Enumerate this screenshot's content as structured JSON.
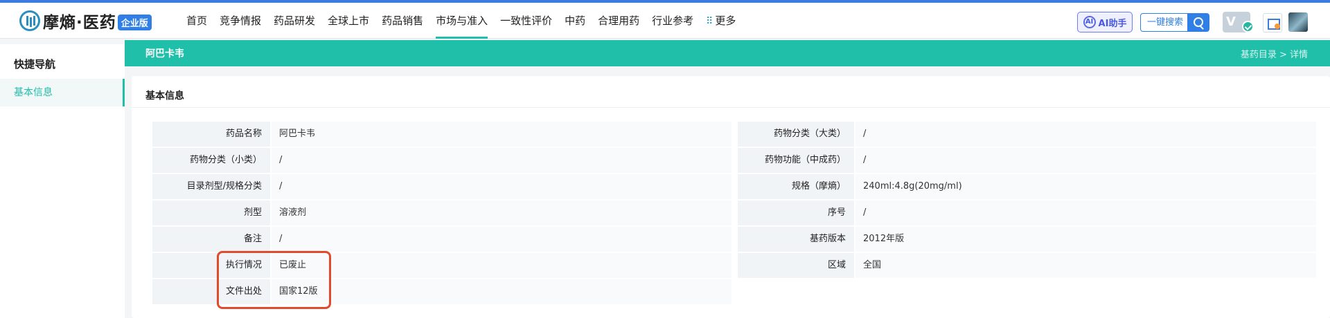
{
  "logo": {
    "text": "摩熵·医药",
    "badge": "企业版"
  },
  "nav": [
    {
      "label": "首页"
    },
    {
      "label": "竞争情报"
    },
    {
      "label": "药品研发"
    },
    {
      "label": "全球上市"
    },
    {
      "label": "药品销售"
    },
    {
      "label": "市场与准入"
    },
    {
      "label": "一致性评价"
    },
    {
      "label": "中药"
    },
    {
      "label": "合理用药"
    },
    {
      "label": "行业参考"
    }
  ],
  "nav_active_index": 5,
  "nav_more": "更多",
  "header": {
    "ai_label": "AI助手",
    "ai_icon_text": "AI",
    "search_label": "一键搜索",
    "vip_text": "V"
  },
  "sidebar": {
    "title": "快捷导航",
    "items": [
      {
        "label": "基本信息"
      }
    ]
  },
  "banner": {
    "title": "阿巴卡韦",
    "breadcrumb": "基药目录 > 详情"
  },
  "card": {
    "title": "基本信息"
  },
  "left_fields": [
    {
      "label": "药品名称",
      "value": "阿巴卡韦"
    },
    {
      "label": "药物分类（小类）",
      "value": "/"
    },
    {
      "label": "目录剂型/规格分类",
      "value": "/"
    },
    {
      "label": "剂型",
      "value": "溶液剂"
    },
    {
      "label": "备注",
      "value": "/"
    },
    {
      "label": "执行情况",
      "value": "已废止"
    },
    {
      "label": "文件出处",
      "value": "国家12版"
    }
  ],
  "right_fields": [
    {
      "label": "药物分类（大类）",
      "value": "/"
    },
    {
      "label": "药物功能（中成药）",
      "value": "/"
    },
    {
      "label": "规格（摩熵）",
      "value": "240ml:4.8g(20mg/ml)"
    },
    {
      "label": "序号",
      "value": "/"
    },
    {
      "label": "基药版本",
      "value": "2012年版"
    },
    {
      "label": "区域",
      "value": "全国"
    }
  ],
  "colors": {
    "accent": "#1fbfaa",
    "primary": "#2f7fe6",
    "highlight": "#e24a2b"
  }
}
